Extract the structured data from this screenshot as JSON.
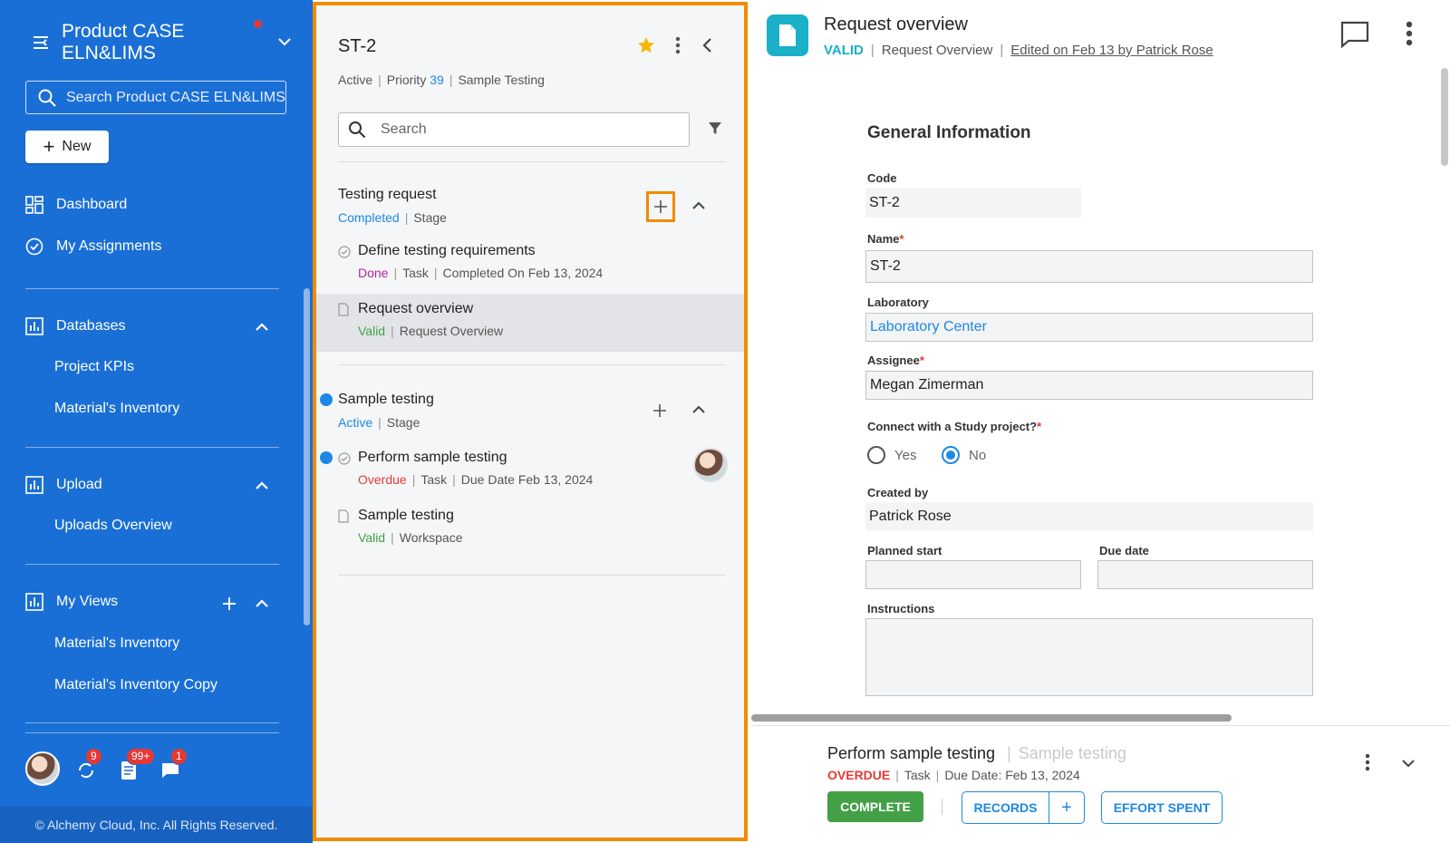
{
  "sidebar": {
    "product_title": "Product CASE ELN&LIMS",
    "search_placeholder": "Search Product CASE ELN&LIMS",
    "new_label": "New",
    "nav": {
      "dashboard": "Dashboard",
      "my_assignments": "My Assignments"
    },
    "databases": {
      "label": "Databases",
      "items": [
        "Project KPIs",
        "Material's Inventory"
      ]
    },
    "upload": {
      "label": "Upload",
      "items": [
        "Uploads Overview"
      ]
    },
    "my_views": {
      "label": "My Views",
      "items": [
        "Material's Inventory",
        "Material's Inventory Copy"
      ]
    },
    "badges": {
      "tasks": "9",
      "records": "99+",
      "messages": "1"
    },
    "footer": "© Alchemy Cloud, Inc. All Rights Reserved."
  },
  "middle": {
    "title": "ST-2",
    "meta": {
      "status": "Active",
      "priority_label": "Priority",
      "priority_value": "39",
      "type": "Sample Testing"
    },
    "search_placeholder": "Search",
    "stages": [
      {
        "title": "Testing request",
        "status": "Completed",
        "kind": "Stage",
        "tasks": [
          {
            "name": "Define testing requirements",
            "status": "Done",
            "kind": "Task",
            "extra": "Completed On Feb 13, 2024"
          },
          {
            "name": "Request overview",
            "status": "Valid",
            "kind": "Request Overview",
            "extra": ""
          }
        ]
      },
      {
        "title": "Sample testing",
        "status": "Active",
        "kind": "Stage",
        "tasks": [
          {
            "name": "Perform sample testing",
            "status": "Overdue",
            "kind": "Task",
            "extra": "Due Date Feb 13, 2024"
          },
          {
            "name": "Sample testing",
            "status": "Valid",
            "kind": "Workspace",
            "extra": ""
          }
        ]
      }
    ]
  },
  "right": {
    "title": "Request overview",
    "meta": {
      "status": "VALID",
      "type": "Request Overview",
      "edited": "Edited on Feb 13 by Patrick Rose"
    },
    "form": {
      "title": "General Information",
      "code_label": "Code",
      "code_value": "ST-2",
      "name_label": "Name",
      "name_value": "ST-2",
      "laboratory_label": "Laboratory",
      "laboratory_value": "Laboratory Center",
      "assignee_label": "Assignee",
      "assignee_value": "Megan Zimerman",
      "connect_label": "Connect with a Study project?",
      "radio_yes": "Yes",
      "radio_no": "No",
      "created_by_label": "Created by",
      "created_by_value": "Patrick Rose",
      "planned_start_label": "Planned start",
      "planned_start_value": "",
      "due_date_label": "Due date",
      "due_date_value": "",
      "instructions_label": "Instructions",
      "instructions_value": "",
      "required_mark": "*"
    },
    "bottom": {
      "title": "Perform sample testing",
      "subtitle": "Sample testing",
      "status": "OVERDUE",
      "kind": "Task",
      "due": "Due Date: Feb 13, 2024",
      "complete_label": "COMPLETE",
      "records_label": "RECORDS",
      "records_plus": "+",
      "effort_label": "EFFORT SPENT"
    }
  },
  "colors": {
    "sidebar_bg": "#1a6fd6",
    "highlight_orange": "#f08c00",
    "accent_blue": "#1e88e5",
    "valid_teal": "#1ab0c7",
    "complete_green": "#43a047",
    "overdue_red": "#e53935"
  },
  "icons": [
    "collapse-menu-icon",
    "chevron-down-icon",
    "search-icon",
    "plus-icon",
    "dashboard-icon",
    "check-circle-icon",
    "chart-icon",
    "chevron-up-icon",
    "star-icon",
    "kebab-icon",
    "chevron-left-icon",
    "filter-icon",
    "document-icon",
    "comment-icon",
    "sync-icon",
    "records-icon",
    "chat-icon"
  ]
}
